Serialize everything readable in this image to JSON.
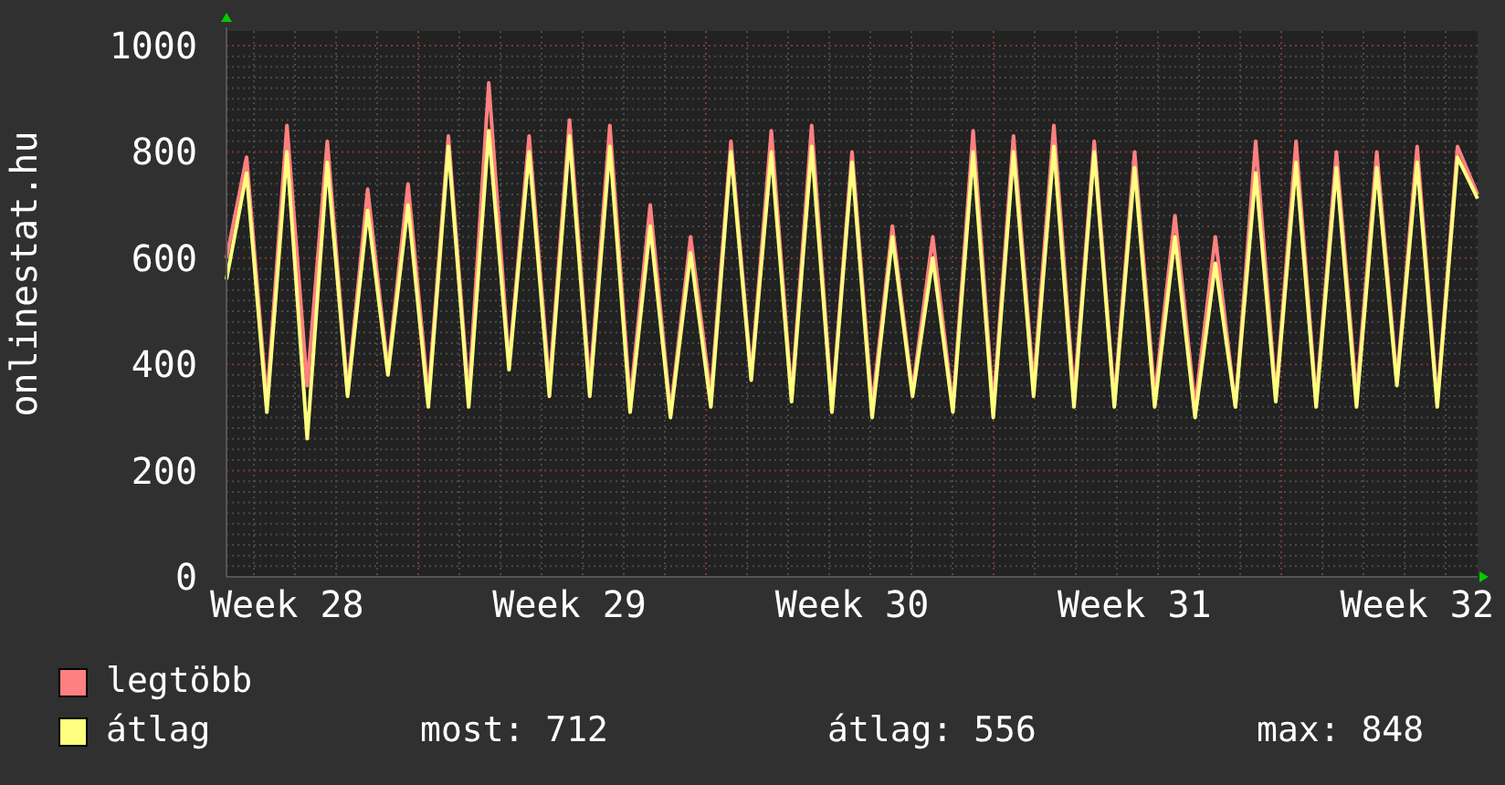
{
  "graph": {
    "chart_data": {
      "type": "line",
      "ylabel": "onlinestat.hu",
      "categories": [
        null,
        null,
        null,
        "Week 28",
        null,
        null,
        null,
        null,
        null,
        null,
        null,
        null,
        null,
        null,
        null,
        null,
        null,
        "Week 29",
        null,
        null,
        null,
        null,
        null,
        null,
        null,
        null,
        null,
        null,
        null,
        null,
        null,
        "Week 30",
        null,
        null,
        null,
        null,
        null,
        null,
        null,
        null,
        null,
        null,
        null,
        null,
        null,
        "Week 31",
        null,
        null,
        null,
        null,
        null,
        null,
        null,
        null,
        null,
        null,
        null,
        null,
        null,
        "Week 32",
        null,
        null,
        null
      ],
      "series": [
        {
          "name": "legtöbb",
          "color": "#ff8080",
          "values": [
            600,
            790,
            330,
            850,
            360,
            820,
            350,
            730,
            390,
            740,
            340,
            830,
            340,
            930,
            400,
            830,
            360,
            860,
            360,
            850,
            330,
            700,
            310,
            640,
            340,
            820,
            380,
            840,
            340,
            850,
            320,
            800,
            320,
            660,
            350,
            640,
            320,
            840,
            320,
            830,
            360,
            850,
            340,
            820,
            330,
            800,
            340,
            680,
            320,
            640,
            320,
            820,
            340,
            820,
            330,
            800,
            340,
            800,
            370,
            810,
            330,
            810,
            720
          ]
        },
        {
          "name": "átlag",
          "color": "#ffff80",
          "values": [
            560,
            760,
            310,
            800,
            260,
            780,
            340,
            690,
            380,
            700,
            320,
            810,
            320,
            840,
            390,
            800,
            340,
            830,
            340,
            810,
            310,
            660,
            300,
            610,
            320,
            800,
            370,
            800,
            330,
            810,
            310,
            780,
            300,
            640,
            340,
            600,
            310,
            800,
            300,
            800,
            340,
            810,
            320,
            800,
            320,
            770,
            320,
            640,
            300,
            590,
            320,
            760,
            330,
            780,
            320,
            770,
            320,
            770,
            360,
            780,
            320,
            790,
            712
          ]
        }
      ],
      "ylim": [
        0,
        1000
      ],
      "yticks": [
        0,
        200,
        400,
        600,
        800,
        1000
      ],
      "grid": true
    },
    "stats": [
      "most: 712",
      "átlag: 556",
      "max: 848"
    ]
  }
}
